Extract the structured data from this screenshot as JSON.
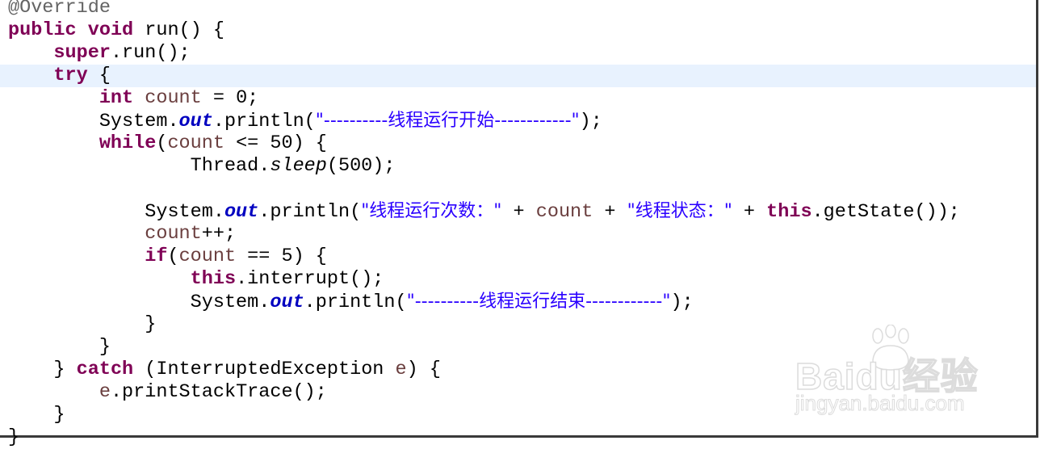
{
  "editor": {
    "language": "java",
    "highlighted_line": 4,
    "lines": [
      {
        "indent": "",
        "tokens": [
          {
            "t": "anno",
            "v": "@Override"
          }
        ]
      },
      {
        "indent": "",
        "tokens": [
          {
            "t": "kw",
            "v": "public"
          },
          {
            "t": "plain",
            "v": " "
          },
          {
            "t": "kw",
            "v": "void"
          },
          {
            "t": "plain",
            "v": " run() {"
          }
        ]
      },
      {
        "indent": "    ",
        "tokens": [
          {
            "t": "kw",
            "v": "super"
          },
          {
            "t": "plain",
            "v": ".run();"
          }
        ]
      },
      {
        "indent": "    ",
        "tokens": [
          {
            "t": "kw",
            "v": "try"
          },
          {
            "t": "plain",
            "v": " {"
          }
        ]
      },
      {
        "indent": "        ",
        "tokens": [
          {
            "t": "kw",
            "v": "int"
          },
          {
            "t": "plain",
            "v": " "
          },
          {
            "t": "var",
            "v": "count"
          },
          {
            "t": "plain",
            "v": " = 0;"
          }
        ]
      },
      {
        "indent": "        ",
        "tokens": [
          {
            "t": "plain",
            "v": "System."
          },
          {
            "t": "field",
            "v": "out"
          },
          {
            "t": "plain",
            "v": ".println("
          },
          {
            "t": "str",
            "v": "\"----------线程运行开始------------\""
          },
          {
            "t": "plain",
            "v": ");"
          }
        ]
      },
      {
        "indent": "        ",
        "tokens": [
          {
            "t": "kw",
            "v": "while"
          },
          {
            "t": "plain",
            "v": "("
          },
          {
            "t": "var",
            "v": "count"
          },
          {
            "t": "plain",
            "v": " <= 50) {"
          }
        ]
      },
      {
        "indent": "                ",
        "tokens": [
          {
            "t": "plain",
            "v": "Thread."
          },
          {
            "t": "static",
            "v": "sleep"
          },
          {
            "t": "plain",
            "v": "(500);"
          }
        ]
      },
      {
        "indent": "",
        "tokens": []
      },
      {
        "indent": "            ",
        "tokens": [
          {
            "t": "plain",
            "v": "System."
          },
          {
            "t": "field",
            "v": "out"
          },
          {
            "t": "plain",
            "v": ".println("
          },
          {
            "t": "str",
            "v": "\"线程运行次数：\""
          },
          {
            "t": "plain",
            "v": " + "
          },
          {
            "t": "var",
            "v": "count"
          },
          {
            "t": "plain",
            "v": " + "
          },
          {
            "t": "str",
            "v": "\"线程状态：\""
          },
          {
            "t": "plain",
            "v": " + "
          },
          {
            "t": "kw",
            "v": "this"
          },
          {
            "t": "plain",
            "v": ".getState());"
          }
        ]
      },
      {
        "indent": "            ",
        "tokens": [
          {
            "t": "var",
            "v": "count"
          },
          {
            "t": "plain",
            "v": "++;"
          }
        ]
      },
      {
        "indent": "            ",
        "tokens": [
          {
            "t": "kw",
            "v": "if"
          },
          {
            "t": "plain",
            "v": "("
          },
          {
            "t": "var",
            "v": "count"
          },
          {
            "t": "plain",
            "v": " == 5) {"
          }
        ]
      },
      {
        "indent": "                ",
        "tokens": [
          {
            "t": "kw",
            "v": "this"
          },
          {
            "t": "plain",
            "v": ".interrupt();"
          }
        ]
      },
      {
        "indent": "                ",
        "tokens": [
          {
            "t": "plain",
            "v": "System."
          },
          {
            "t": "field",
            "v": "out"
          },
          {
            "t": "plain",
            "v": ".println("
          },
          {
            "t": "str",
            "v": "\"----------线程运行结束------------\""
          },
          {
            "t": "plain",
            "v": ");"
          }
        ]
      },
      {
        "indent": "            ",
        "tokens": [
          {
            "t": "plain",
            "v": "}"
          }
        ]
      },
      {
        "indent": "        ",
        "tokens": [
          {
            "t": "plain",
            "v": "}"
          }
        ]
      },
      {
        "indent": "    ",
        "tokens": [
          {
            "t": "plain",
            "v": "} "
          },
          {
            "t": "kw",
            "v": "catch"
          },
          {
            "t": "plain",
            "v": " (InterruptedException "
          },
          {
            "t": "var",
            "v": "e"
          },
          {
            "t": "plain",
            "v": ") {"
          }
        ]
      },
      {
        "indent": "        ",
        "tokens": [
          {
            "t": "var",
            "v": "e"
          },
          {
            "t": "plain",
            "v": ".printStackTrace();"
          }
        ]
      },
      {
        "indent": "    ",
        "tokens": [
          {
            "t": "plain",
            "v": "}"
          }
        ]
      },
      {
        "indent": "",
        "tokens": [
          {
            "t": "plain",
            "v": "}"
          }
        ]
      }
    ]
  },
  "watermark": {
    "logo_text": "Baidu经验",
    "url": "jingyan.baidu.com"
  },
  "colors": {
    "keyword": "#7f0055",
    "variable": "#6a3e3e",
    "string": "#2a00ff",
    "field": "#0000c0",
    "annotation": "#646464",
    "current_line": "#e8f2fe"
  }
}
